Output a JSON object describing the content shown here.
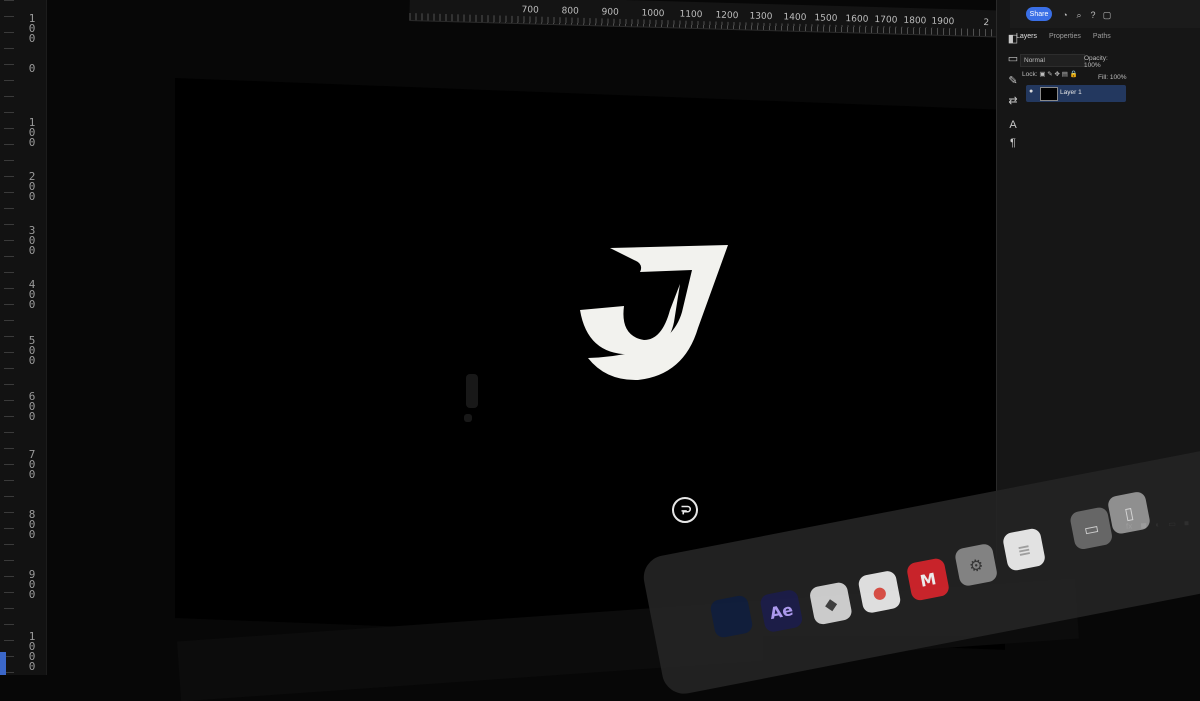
{
  "left_ruler": {
    "labels": [
      "100",
      "0",
      "100",
      "200",
      "300",
      "400",
      "500",
      "600",
      "700",
      "800",
      "900",
      "1000"
    ]
  },
  "top_ruler": {
    "labels": [
      "700",
      "800",
      "900",
      "1000",
      "1100",
      "1200",
      "1300",
      "1400",
      "1500",
      "1600",
      "1700",
      "1800",
      "1900",
      "2"
    ]
  },
  "header": {
    "share_label": "Share"
  },
  "layers_panel": {
    "tabs": [
      "Layers",
      "Properties",
      "Paths"
    ],
    "blend_mode": "Normal",
    "opacity_label": "Opacity: 100%",
    "lock_label": "Lock:",
    "fill_label": "Fill: 100%",
    "layer_name": "Layer 1"
  },
  "dock": {
    "apps": [
      "Ae",
      "M"
    ]
  },
  "colors": {
    "accent": "#3a6fe6",
    "layer_selected": "#23385f",
    "canvas": "#000000",
    "logo": "#f2f2ee"
  },
  "icons": [
    "search-icon",
    "bell-icon",
    "help-icon",
    "window-icon",
    "eye-icon",
    "crosshair-icon"
  ]
}
